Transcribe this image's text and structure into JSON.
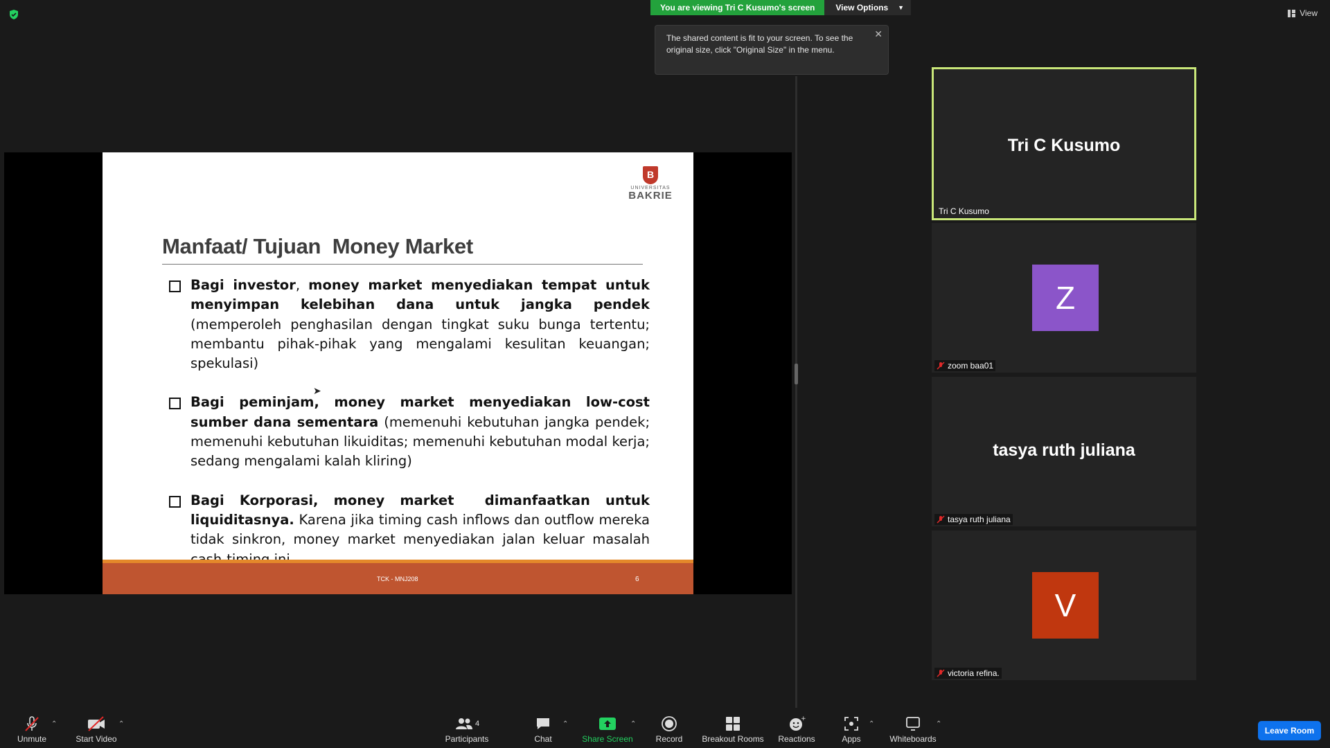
{
  "topbar": {
    "viewing_text": "You are viewing Tri C Kusumo's screen",
    "view_options_label": "View Options",
    "view_label": "View"
  },
  "tooltip": {
    "text": "The shared content is fit to your screen. To see the original size, click \"Original Size\" in the menu."
  },
  "slide": {
    "logo_university": "UNIVERSITAS",
    "logo_name": "BAKRIE",
    "title": "Manfaat/ Tujuan  Money Market",
    "bullets": [
      {
        "bold": "Bagi investor",
        "text1": ", ",
        "bold2": "money market menyediakan tempat untuk menyimpan kelebihan dana untuk jangka pendek",
        "text2": " (memperoleh penghasilan dengan tingkat suku bunga tertentu; membantu pihak-pihak yang mengalami kesulitan keuangan; spekulasi)"
      },
      {
        "bold": "Bagi peminjam, money market menyediakan low-cost sumber dana sementara",
        "text1": " (memenuhi kebutuhan jangka pendek; memenuhi kebutuhan likuiditas;  memenuhi kebutuhan modal kerja; sedang mengalami kalah kliring)",
        "bold2": "",
        "text2": ""
      },
      {
        "bold": "Bagi Korporasi, money market  dimanfaatkan untuk liquiditasnya.",
        "text1": " Karena jika timing cash inflows dan outflow mereka tidak sinkron, money market menyediakan jalan keluar masalah cash-timing ini.",
        "bold2": "",
        "text2": ""
      }
    ],
    "footer_code": "TCK - MNJ208",
    "page_number": "6"
  },
  "participants": [
    {
      "display": "Tri C Kusumo",
      "label": "Tri C Kusumo",
      "muted": false,
      "active": true
    },
    {
      "display": "Z",
      "label": "zoom baa01",
      "muted": true,
      "avatar_color": "#8b55c9"
    },
    {
      "display": "tasya ruth juliana",
      "label": "tasya ruth juliana",
      "muted": true
    },
    {
      "display": "V",
      "label": "victoria refina.",
      "muted": true,
      "avatar_color": "#c0370f"
    }
  ],
  "toolbar": {
    "unmute": "Unmute",
    "start_video": "Start Video",
    "participants": "Participants",
    "participants_count": "4",
    "chat": "Chat",
    "share_screen": "Share Screen",
    "record": "Record",
    "breakout_rooms": "Breakout Rooms",
    "reactions": "Reactions",
    "apps": "Apps",
    "whiteboards": "Whiteboards",
    "leave_room": "Leave Room"
  },
  "colors": {
    "accent_green": "#23a23c",
    "active_speaker_border": "#c9e779",
    "slide_footer": "#bf5530",
    "leave_button": "#0e72ed"
  }
}
